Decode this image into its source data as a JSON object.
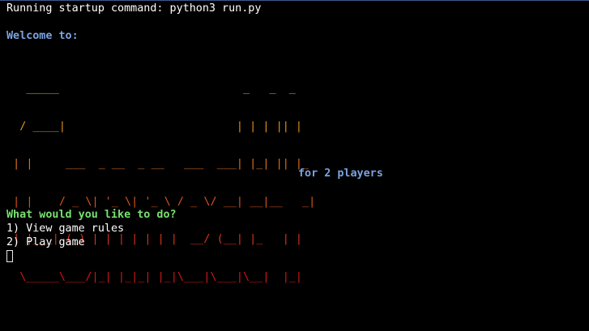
{
  "terminal": {
    "startup_line": "Running startup command: python3 run.py",
    "welcome": "Welcome to:",
    "banner_lines": [
      "   _____                            _   _  _",
      "  / ____|                          | | | || |",
      " | |     ___  _ __  _ __   ___  ___| |_| || |_",
      " | |    / _ \\| '_ \\| '_ \\ / _ \\/ __| __|__   _|",
      " | |___| (_) | | | | | | |  __/ (__| |_   | |",
      "  \\_____\\___/|_| |_|_| |_|\\___|\\___|\\__|  |_|"
    ],
    "subtitle": "for 2 players",
    "menu_prompt": "What would you like to do?",
    "menu_options": [
      "1) View game rules",
      "2) Play game"
    ]
  },
  "colors": {
    "background": "#000000",
    "default_text": "#ffffff",
    "welcome_blue": "#7aa3e0",
    "subtitle_blue": "#7aa3e0",
    "prompt_green": "#78e070",
    "banner_gradient_top": "#e8b020",
    "banner_gradient_bottom": "#d01818"
  }
}
